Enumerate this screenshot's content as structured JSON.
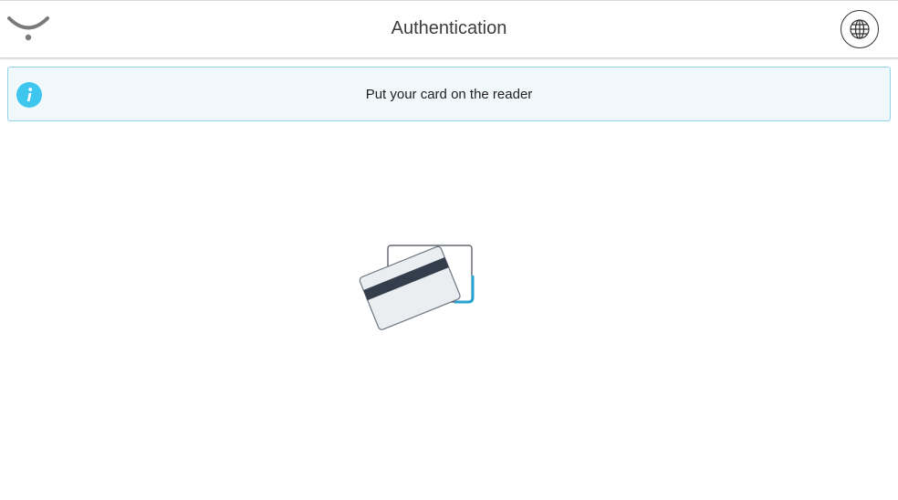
{
  "header": {
    "title": "Authentication",
    "logo_icon": "smile-logo-icon",
    "language_icon": "globe-icon"
  },
  "banner": {
    "icon": "info-icon",
    "message": "Put your card on the reader"
  },
  "illustration": {
    "icon": "payment-card-icon"
  },
  "colors": {
    "banner_background": "#f1f8fb",
    "banner_border": "#8fd3ea",
    "info_icon": "#3ec6ee",
    "card_accent": "#29a3d0",
    "card_stripe": "#343d4b"
  }
}
